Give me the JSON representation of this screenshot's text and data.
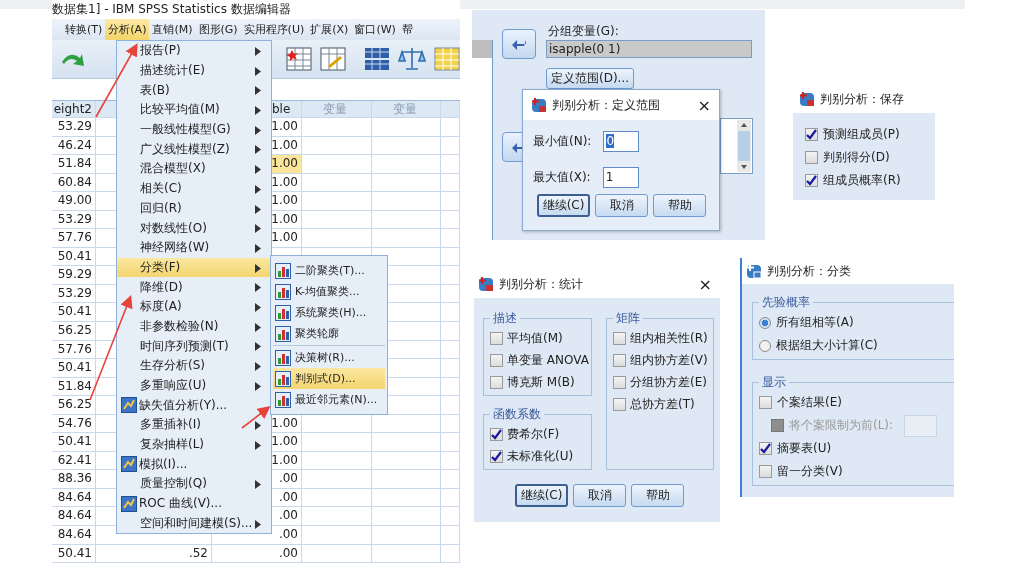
{
  "data_editor": {
    "title": "数据集1] - IBM SPSS Statistics 数据编辑器",
    "menu_bar": [
      {
        "label": "转换(T)",
        "selected": false
      },
      {
        "label": "分析(A)",
        "selected": true
      },
      {
        "label": "直销(M)",
        "selected": false
      },
      {
        "label": "图形(G)",
        "selected": false
      },
      {
        "label": "实用程序(U)",
        "selected": false
      },
      {
        "label": "扩展(X)",
        "selected": false
      },
      {
        "label": "窗口(W)",
        "selected": false
      },
      {
        "label": "帮",
        "selected": false
      }
    ],
    "headers": {
      "column_1": "eight2",
      "column_3": "ble",
      "column_4": "变量",
      "column_5": "变量"
    },
    "rows": [
      {
        "column_1": "53.29",
        "column_3": "1.00",
        "selected": false
      },
      {
        "column_1": "46.24",
        "column_3": "1.00",
        "selected": false
      },
      {
        "column_1": "51.84",
        "column_3": "1.00",
        "selected": true
      },
      {
        "column_1": "60.84",
        "column_3": "1.00",
        "selected": false
      },
      {
        "column_1": "49.00",
        "column_3": "1.00",
        "selected": false
      },
      {
        "column_1": "53.29",
        "column_3": "1.00",
        "selected": false
      },
      {
        "column_1": "57.76",
        "column_3": "1.00",
        "selected": false
      },
      {
        "column_1": "50.41"
      },
      {
        "column_1": "59.29"
      },
      {
        "column_1": "53.29"
      },
      {
        "column_1": "50.41"
      },
      {
        "column_1": "56.25"
      },
      {
        "column_1": "57.76"
      },
      {
        "column_1": "50.41"
      },
      {
        "column_1": "51.84"
      },
      {
        "column_1": "56.25"
      },
      {
        "column_1": "54.76",
        "column_3": "1.00",
        "selected": false
      },
      {
        "column_1": "50.41",
        "column_3": "1.00",
        "selected": false
      },
      {
        "column_1": "62.41",
        "column_3": "1.00",
        "selected": false
      },
      {
        "column_1": "88.36",
        "column_3": ".00",
        "selected": false
      },
      {
        "column_1": "84.64",
        "column_3": ".00",
        "selected": false
      },
      {
        "column_1": "84.64",
        "column_3": ".00",
        "selected": false
      },
      {
        "column_1": "84.64",
        "column_3": ".00",
        "selected": false
      },
      {
        "column_1": "50.41",
        "column_2": ".52",
        "column_3": ".00",
        "selected": false
      }
    ],
    "menu": [
      {
        "label": "报告(P)",
        "kind": "submenu",
        "selected": false
      },
      {
        "label": "描述统计(E)",
        "kind": "submenu",
        "selected": false
      },
      {
        "label": "表(B)",
        "kind": "submenu",
        "selected": false
      },
      {
        "label": "比较平均值(M)",
        "kind": "submenu",
        "selected": false
      },
      {
        "label": "一般线性模型(G)",
        "kind": "submenu",
        "selected": false
      },
      {
        "label": "广义线性模型(Z)",
        "kind": "submenu",
        "selected": false
      },
      {
        "label": "混合模型(X)",
        "kind": "submenu",
        "selected": false
      },
      {
        "label": "相关(C)",
        "kind": "submenu",
        "selected": false
      },
      {
        "label": "回归(R)",
        "kind": "submenu",
        "selected": false
      },
      {
        "label": "对数线性(O)",
        "kind": "submenu",
        "selected": false
      },
      {
        "label": "神经网络(W)",
        "kind": "submenu",
        "selected": false
      },
      {
        "label": "分类(F)",
        "kind": "submenu",
        "selected": true
      },
      {
        "label": "降维(D)",
        "kind": "submenu",
        "selected": false
      },
      {
        "label": "标度(A)",
        "kind": "submenu",
        "selected": false
      },
      {
        "label": "非参数检验(N)",
        "kind": "submenu",
        "selected": false
      },
      {
        "label": "时间序列预测(T)",
        "kind": "submenu",
        "selected": false
      },
      {
        "label": "生存分析(S)",
        "kind": "submenu",
        "selected": false
      },
      {
        "label": "多重响应(U)",
        "kind": "submenu",
        "selected": false
      },
      {
        "label": "缺失值分析(Y)...",
        "kind": "command",
        "selected": false
      },
      {
        "label": "多重插补(I)",
        "kind": "submenu",
        "selected": false
      },
      {
        "label": "复杂抽样(L)",
        "kind": "submenu",
        "selected": false
      },
      {
        "label": "模拟(I)...",
        "kind": "command",
        "selected": false
      },
      {
        "label": "质量控制(Q)",
        "kind": "submenu",
        "selected": false
      },
      {
        "label": "ROC 曲线(V)...",
        "kind": "command",
        "selected": false
      },
      {
        "label": "空间和时间建模(S)...",
        "kind": "submenu",
        "selected": false
      }
    ],
    "submenu": [
      [
        {
          "label": "二阶聚类(T)...",
          "selected": false
        },
        {
          "label": "K-均值聚类...",
          "selected": false
        },
        {
          "label": "系统聚类(H)...",
          "selected": false
        },
        {
          "label": "聚类轮廓",
          "selected": false
        }
      ],
      [
        {
          "label": "决策树(R)...",
          "selected": false
        },
        {
          "label": "判别式(D)...",
          "selected": true
        },
        {
          "label": "最近邻元素(N)...",
          "selected": false
        }
      ]
    ]
  },
  "discriminant_dialog": {
    "grouping_label": "分组变量(G):",
    "grouping_value": "isapple(0 1)",
    "define_range_button": "定义范围(D)..."
  },
  "define_range_dialog": {
    "title": "判别分析：定义范围",
    "close": "×",
    "fields": [
      {
        "label": "最小值(N):",
        "value": "0",
        "selected": true
      },
      {
        "label": "最大值(X):",
        "value": "1",
        "selected": false
      }
    ],
    "buttons": [
      {
        "label": "继续(C)",
        "default": true
      },
      {
        "label": "取消",
        "default": false
      },
      {
        "label": "帮助",
        "default": false
      }
    ]
  },
  "save_dialog": {
    "title": "判别分析：保存",
    "options": [
      {
        "label": "预测组成员(P)",
        "checked": true
      },
      {
        "label": "判别得分(D)",
        "checked": false
      },
      {
        "label": "组成员概率(R)",
        "checked": true
      }
    ]
  },
  "statistics_dialog": {
    "title": "判别分析：统计",
    "close": "×",
    "groups": [
      {
        "title": "描述",
        "options": [
          {
            "label": "平均值(M)",
            "checked": false
          },
          {
            "label": "单变量 ANOVA",
            "checked": false
          },
          {
            "label": "博克斯 M(B)",
            "checked": false
          }
        ]
      },
      {
        "title": "函数系数",
        "options": [
          {
            "label": "费希尔(F)",
            "checked": true
          },
          {
            "label": "未标准化(U)",
            "checked": true
          }
        ]
      },
      {
        "title": "矩阵",
        "options": [
          {
            "label": "组内相关性(R)",
            "checked": false
          },
          {
            "label": "组内协方差(V)",
            "checked": false
          },
          {
            "label": "分组协方差(E)",
            "checked": false
          },
          {
            "label": "总协方差(T)",
            "checked": false
          }
        ]
      }
    ],
    "buttons": [
      {
        "label": "继续(C)",
        "default": true
      },
      {
        "label": "取消",
        "default": false
      },
      {
        "label": "帮助",
        "default": false
      }
    ]
  },
  "classify_dialog": {
    "title": "判别分析：分类",
    "prior_probabilities": {
      "title": "先验概率",
      "options": [
        {
          "label": "所有组相等(A)",
          "selected": true
        },
        {
          "label": "根据组大小计算(C)",
          "selected": false
        }
      ]
    },
    "display": {
      "title": "显示",
      "options": [
        {
          "label": "个案结果(E)",
          "kind": "checkbox",
          "checked": false,
          "disabled": false
        },
        {
          "label": "将个案限制为前(L):",
          "kind": "limit",
          "checked": false,
          "disabled": true
        },
        {
          "label": "摘要表(U)",
          "kind": "checkbox",
          "checked": true,
          "disabled": false
        },
        {
          "label": "留一分类(V)",
          "kind": "checkbox",
          "checked": false,
          "disabled": false
        }
      ]
    }
  }
}
